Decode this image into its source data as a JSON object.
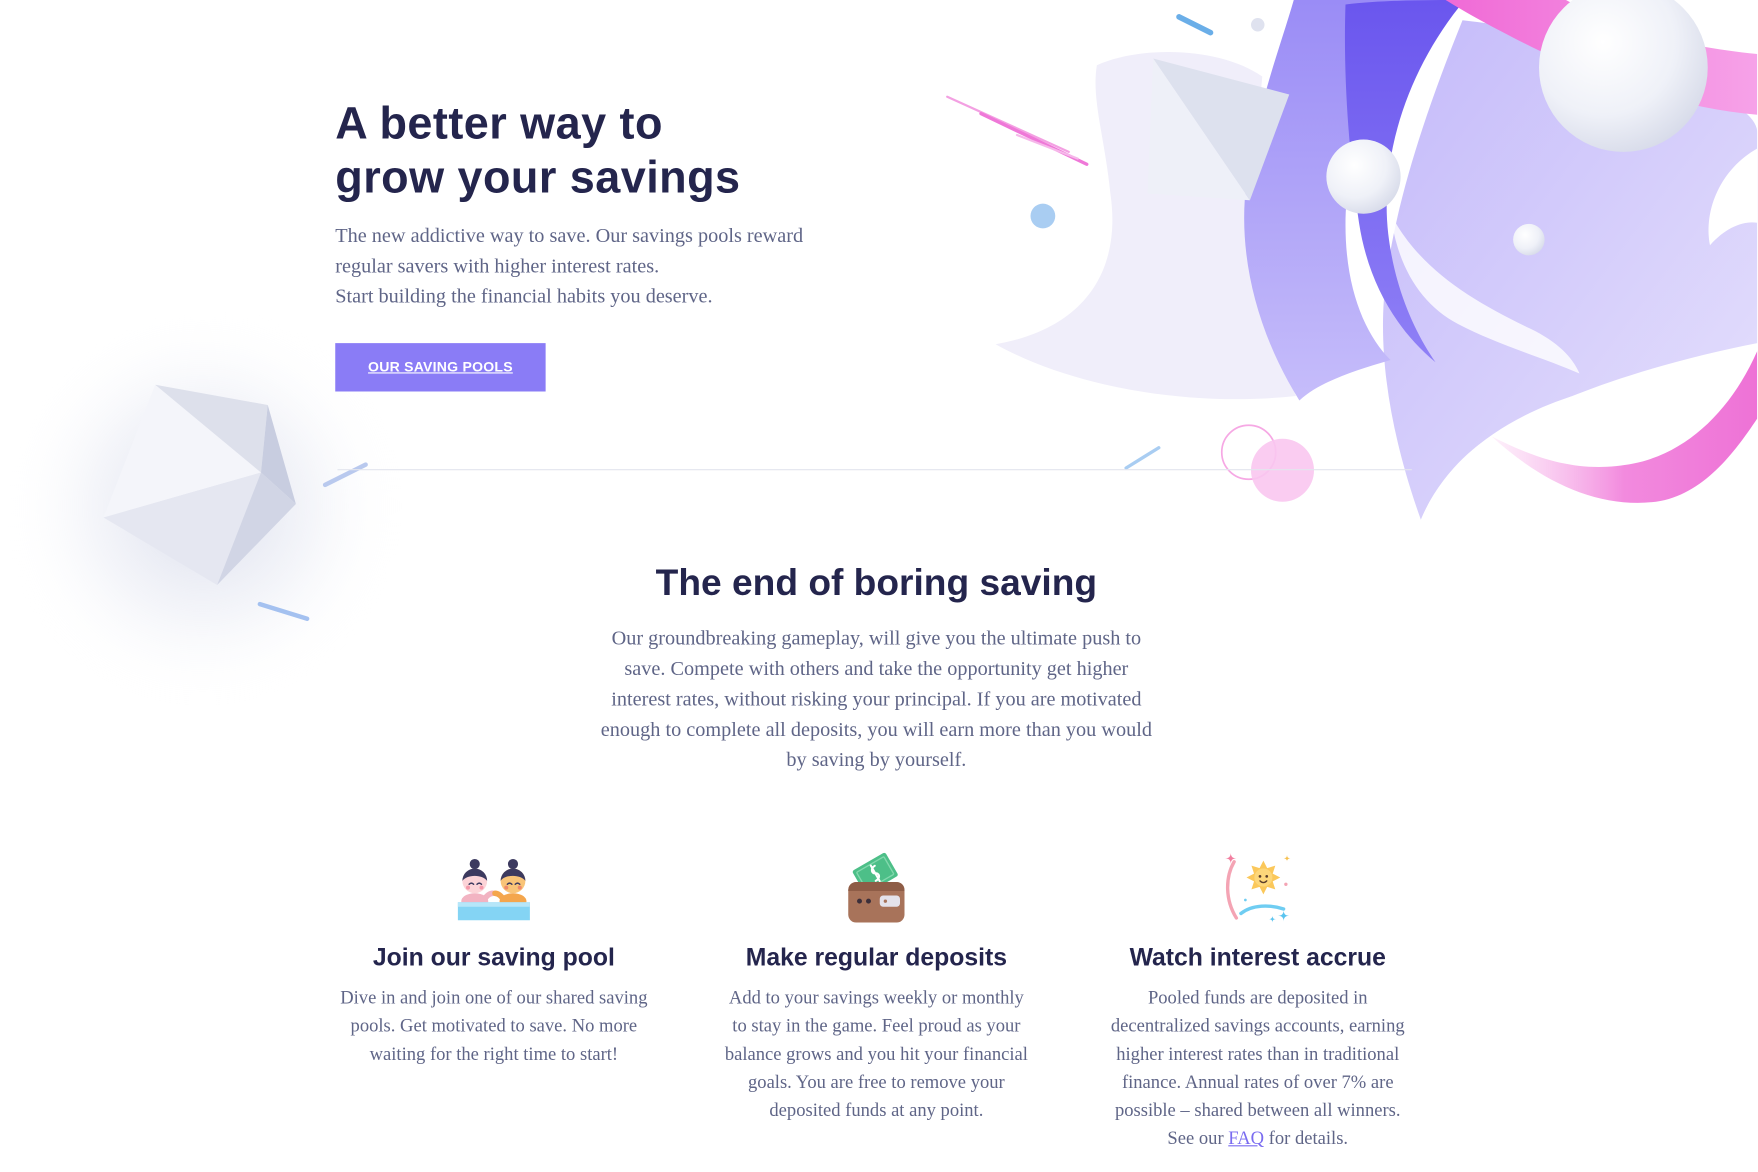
{
  "hero": {
    "title_lines": [
      "A better way to",
      "grow your savings"
    ],
    "subtitle_lines": [
      "The new addictive way to save. Our savings pools reward",
      "regular savers with higher interest rates.",
      "Start building the financial habits you deserve."
    ],
    "cta_label": "OUR SAVING POOLS"
  },
  "intro": {
    "title": "The end of boring saving",
    "body_lines": [
      "Our groundbreaking gameplay, will give you the ultimate push to",
      "save. Compete with others and take the opportunity get higher",
      "interest rates, without risking your principal. If you are motivated",
      "enough to complete all deposits, you will earn more than you would",
      "by saving by yourself."
    ]
  },
  "features": {
    "items": [
      {
        "icon": "swimmers-icon",
        "title": "Join our saving pool",
        "lines": [
          "Dive in and join one of our shared saving",
          "pools. Get motivated to save. No more",
          "waiting for the right time to start!"
        ]
      },
      {
        "icon": "wallet-icon",
        "title": "Make regular deposits",
        "lines": [
          "Add to your savings weekly or monthly",
          "to stay in the game. Feel proud as your",
          "balance grows and you hit your financial",
          "goals. You are free to remove your",
          "deposited funds at any point."
        ]
      },
      {
        "icon": "sparkle-star-icon",
        "title": "Watch interest accrue",
        "lines": [
          "Pooled funds are deposited in",
          "decentralized savings accounts, earning",
          "higher interest rates than in traditional",
          "finance. Annual rates of over 7% are",
          "possible – shared between all winners."
        ],
        "faq": {
          "prefix": "See our ",
          "link": "FAQ",
          "suffix": " for details."
        }
      }
    ]
  },
  "colors": {
    "heading": "#24254d",
    "body_text": "#5f6587",
    "accent": "#8a7cf6",
    "link": "#7a6cf0",
    "illustration_purple": "#7460f0",
    "illustration_pink": "#f06ad6"
  }
}
